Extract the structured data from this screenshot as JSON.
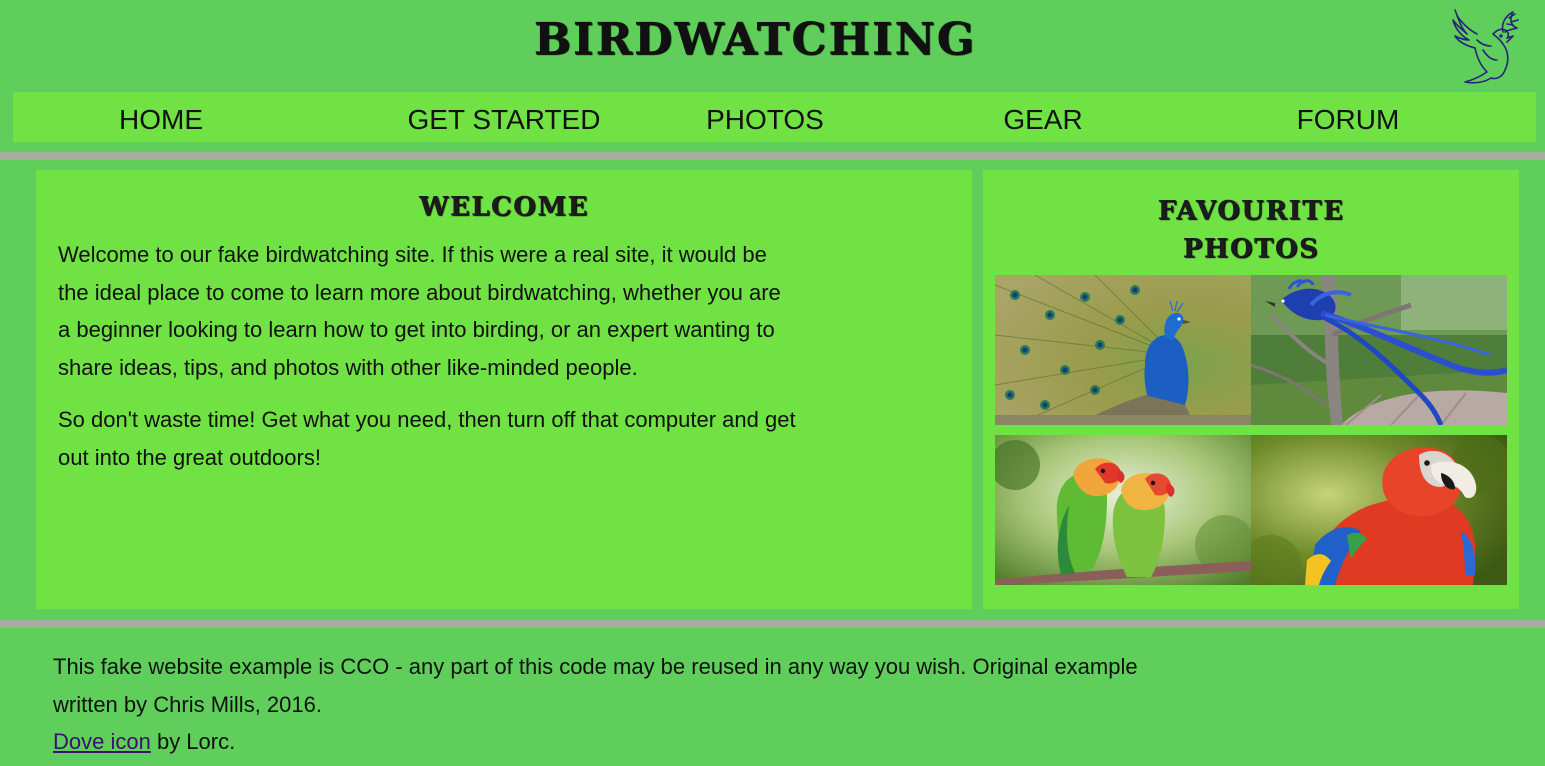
{
  "header": {
    "title": "BIRDWATCHING",
    "logo_icon": "dove-icon"
  },
  "nav": {
    "items": [
      {
        "label": "HOME"
      },
      {
        "label": "GET STARTED"
      },
      {
        "label": "PHOTOS"
      },
      {
        "label": "GEAR"
      },
      {
        "label": "FORUM"
      }
    ]
  },
  "welcome": {
    "heading": "WELCOME",
    "paragraph1": "Welcome to our fake birdwatching site. If this were a real site, it would be the ideal place to come to learn more about birdwatching, whether you are a beginner looking to learn how to get into birding, or an expert wanting to share ideas, tips, and photos with other like-minded people.",
    "paragraph2": "So don't waste time! Get what you need, then turn off that computer and get out into the great outdoors!"
  },
  "photos": {
    "heading_line1": "FAVOURITE",
    "heading_line2": "PHOTOS",
    "images": [
      {
        "subject": "peacock"
      },
      {
        "subject": "blue-bird"
      },
      {
        "subject": "lovebirds"
      },
      {
        "subject": "parrot"
      }
    ]
  },
  "footer": {
    "text": "This fake website example is CCO - any part of this code may be reused in any way you wish. Original example written by Chris Mills, 2016.",
    "link_label": "Dove icon",
    "link_suffix": " by Lorc."
  },
  "colors": {
    "page_bg": "#5fce5a",
    "panel_bg": "#70e243",
    "divider": "#a7ad9f",
    "link": "#3b1270"
  }
}
